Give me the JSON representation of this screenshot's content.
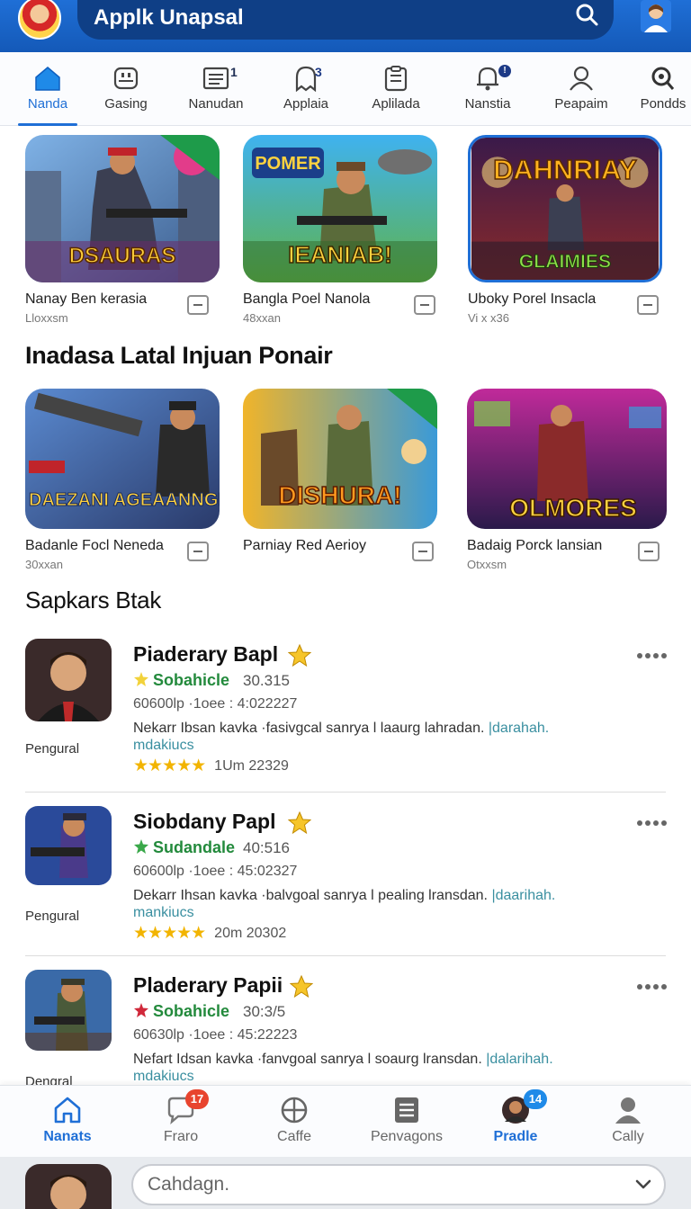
{
  "header": {
    "title": "Applk Unapsal",
    "search_icon": "search-icon",
    "profile_icon": "profile-icon"
  },
  "tabs": [
    {
      "label": "Nanda",
      "icon": "home-icon",
      "badge": ""
    },
    {
      "label": "Gasing",
      "icon": "store-icon",
      "badge": ""
    },
    {
      "label": "Nanudan",
      "icon": "list-icon",
      "badge": "1"
    },
    {
      "label": "Applaia",
      "icon": "ghost-icon",
      "badge": "3"
    },
    {
      "label": "Aplilada",
      "icon": "clipboard-icon",
      "badge": ""
    },
    {
      "label": "Nanstia",
      "icon": "bell-icon",
      "badge": "!"
    },
    {
      "label": "Peapaim",
      "icon": "user-icon",
      "badge": ""
    },
    {
      "label": "Pondds",
      "icon": "search-icon",
      "badge": ""
    }
  ],
  "featured_row_1": [
    {
      "name": "Nanay Ben kerasia",
      "sub": "Lloxxsm",
      "art": "DSAURAS"
    },
    {
      "name": "Bangla Poel Nanola",
      "sub": "48xxan",
      "art": "IEANIAB!"
    },
    {
      "name": "Uboky Porel Insacla",
      "sub": "Vi x x36",
      "art": "DAHNRIAY"
    }
  ],
  "section_1": {
    "title": "Inadasa Latal Injuan Ponair"
  },
  "featured_row_2": [
    {
      "name": "Badanle Focl Neneda",
      "sub": "30xxan",
      "art": "DAEZANI AGEAANNGI!"
    },
    {
      "name": "Parniay Red Aerioy",
      "sub": "",
      "art": "DISHURA!"
    },
    {
      "name": "Badaig Porck lansian",
      "sub": "Otxxsm",
      "art": "OLMORES"
    }
  ],
  "section_2": {
    "title": "Sapkars Btak"
  },
  "list_items": [
    {
      "title": "Piaderary Bapl",
      "category": "Sobahicle",
      "version": "30.315",
      "meta": "60600lp ·1oee : 4:022227",
      "desc": "Nekarr Ibsan kavka ·fasivgcal sanrya l laaurg lahradan.",
      "link": "|darahah.",
      "desc2": "mdakiucs",
      "stars": "★★★★★",
      "rating_text": "1Um 22329",
      "publisher": "Pengural"
    },
    {
      "title": "Siobdany Papl",
      "category": "Sudandale",
      "version": "40:516",
      "meta": "60600lp ·1oee : 45:02327",
      "desc": "Dekarr Ihsan kavka ·balvgoal sanrya l pealing lransdan.",
      "link": "|daarihah.",
      "desc2": "mankiucs",
      "stars": "★★★★★",
      "rating_text": "20m 20302",
      "publisher": "Pengural"
    },
    {
      "title": "Pladerary Papii",
      "category": "Sobahicle",
      "version": "30:3/5",
      "meta": "60630lp ·1oee : 45:22223",
      "desc": "Nefart Idsan kavka ·fanvgoal sanrya l soaurg lransdan.",
      "link": "|dalarihah.",
      "desc2": "mdakiucs",
      "stars": "",
      "rating_text": "",
      "publisher": "Dengral"
    }
  ],
  "bottom_nav": [
    {
      "label": "Nanats",
      "icon": "home-icon",
      "badge": ""
    },
    {
      "label": "Fraro",
      "icon": "chat-icon",
      "badge": "17"
    },
    {
      "label": "Caffe",
      "icon": "globe-icon",
      "badge": ""
    },
    {
      "label": "Penvagons",
      "icon": "list-icon",
      "badge": ""
    },
    {
      "label": "Pradle",
      "icon": "avatar-icon",
      "badge": "14"
    },
    {
      "label": "Cally",
      "icon": "user-icon",
      "badge": ""
    }
  ],
  "footer": {
    "placeholder": "Cahdagn."
  },
  "colors": {
    "primary": "#1f6fd6",
    "header_dark": "#0f3f86",
    "green": "#238a3c",
    "star": "#f2b400",
    "badge_red": "#e8442e"
  }
}
